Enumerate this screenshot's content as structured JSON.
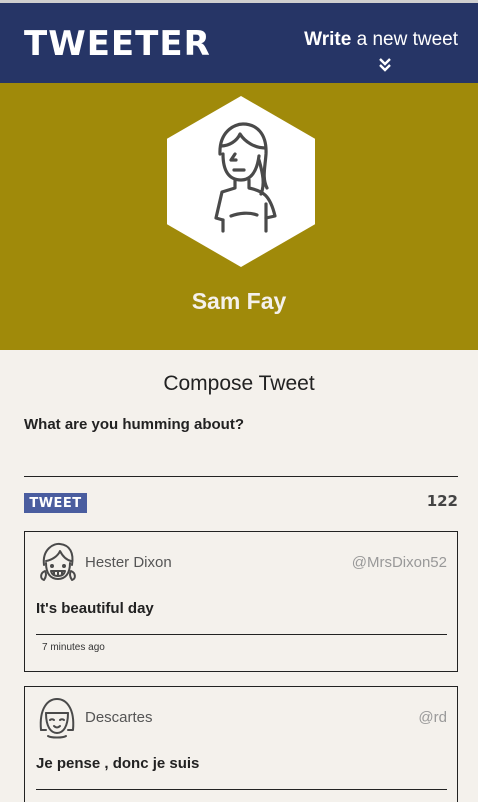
{
  "nav": {
    "brand": "TWEETER",
    "write_bold": "Write",
    "write_rest": " a new tweet",
    "chevron_icon": "double-chevron-down-icon"
  },
  "profile": {
    "name": "Sam Fay",
    "avatar_icon": "woman-avatar-icon"
  },
  "compose": {
    "title": "Compose Tweet",
    "label": "What are you humming about?",
    "value": "",
    "button": "TWEET",
    "counter": "122"
  },
  "tweets": [
    {
      "user": "Hester Dixon",
      "handle": "@MrsDixon52",
      "text": "It's beautiful day",
      "time": "7 minutes ago",
      "avatar_icon": "smiling-girl-avatar-icon"
    },
    {
      "user": "Descartes",
      "handle": "@rd",
      "text": "Je pense , donc je suis",
      "time": "",
      "avatar_icon": "bob-hair-avatar-icon"
    }
  ],
  "colors": {
    "nav": "#263566",
    "banner": "#a08a0a",
    "background": "#f4f1ec",
    "button": "#4a5d9f"
  }
}
